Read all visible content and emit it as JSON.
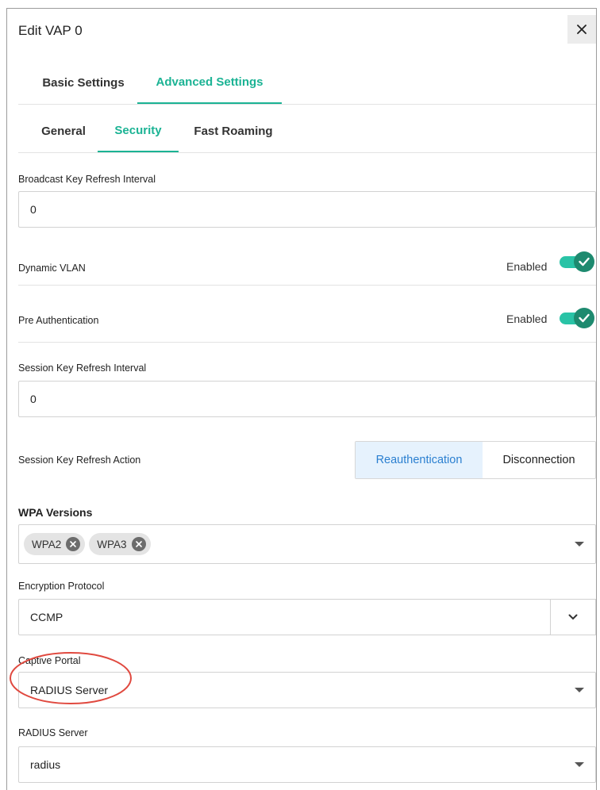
{
  "dialog": {
    "title": "Edit VAP 0",
    "close_icon": "close-icon"
  },
  "tabs": [
    {
      "label": "Basic Settings",
      "active": false
    },
    {
      "label": "Advanced Settings",
      "active": true
    }
  ],
  "subtabs": [
    {
      "label": "General",
      "active": false
    },
    {
      "label": "Security",
      "active": true
    },
    {
      "label": "Fast Roaming",
      "active": false
    }
  ],
  "fields": {
    "broadcast_key": {
      "label": "Broadcast Key Refresh Interval",
      "value": "0"
    },
    "dynamic_vlan": {
      "label": "Dynamic VLAN",
      "state_text": "Enabled",
      "enabled": true
    },
    "pre_auth": {
      "label": "Pre Authentication",
      "state_text": "Enabled",
      "enabled": true
    },
    "session_key": {
      "label": "Session Key Refresh Interval",
      "value": "0"
    },
    "session_action": {
      "label": "Session Key Refresh Action",
      "options": [
        "Reauthentication",
        "Disconnection"
      ],
      "selected": "Reauthentication"
    },
    "wpa_versions": {
      "label": "WPA Versions",
      "chips": [
        "WPA2",
        "WPA3"
      ]
    },
    "encryption": {
      "label": "Encryption Protocol",
      "value": "CCMP"
    },
    "captive_portal": {
      "label": "Captive Portal",
      "value": "RADIUS Server"
    },
    "radius_server": {
      "label": "RADIUS Server",
      "value": "radius"
    }
  },
  "colors": {
    "accent": "#1bb394",
    "toggle_track": "#29c3a6",
    "toggle_knob": "#1e8a6f",
    "segment_active_bg": "#e6f2fd",
    "segment_active_text": "#2a7fd0",
    "annotation": "#e0493f"
  }
}
